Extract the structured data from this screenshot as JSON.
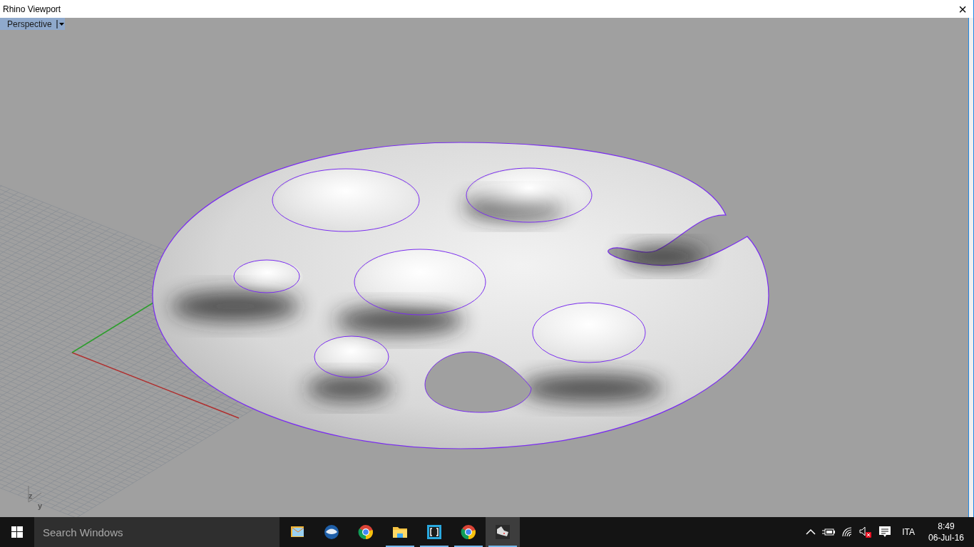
{
  "window": {
    "title": "Rhino Viewport",
    "close": "×"
  },
  "viewport": {
    "label": "Perspective",
    "axis_labels": [
      "z",
      "y"
    ]
  },
  "taskbar": {
    "search": {
      "placeholder": "Search Windows"
    },
    "apps": [
      {
        "kind": "mail",
        "running": false,
        "selected": false
      },
      {
        "kind": "bird",
        "running": false,
        "selected": false
      },
      {
        "kind": "browser",
        "running": false,
        "selected": false
      },
      {
        "kind": "folder",
        "running": true,
        "selected": false
      },
      {
        "kind": "brackets",
        "running": true,
        "selected": false
      },
      {
        "kind": "browser",
        "running": true,
        "selected": false
      },
      {
        "kind": "rhino",
        "running": true,
        "selected": true
      }
    ],
    "language": "ITA",
    "time": "8:49",
    "date": "06-Jul-16"
  }
}
